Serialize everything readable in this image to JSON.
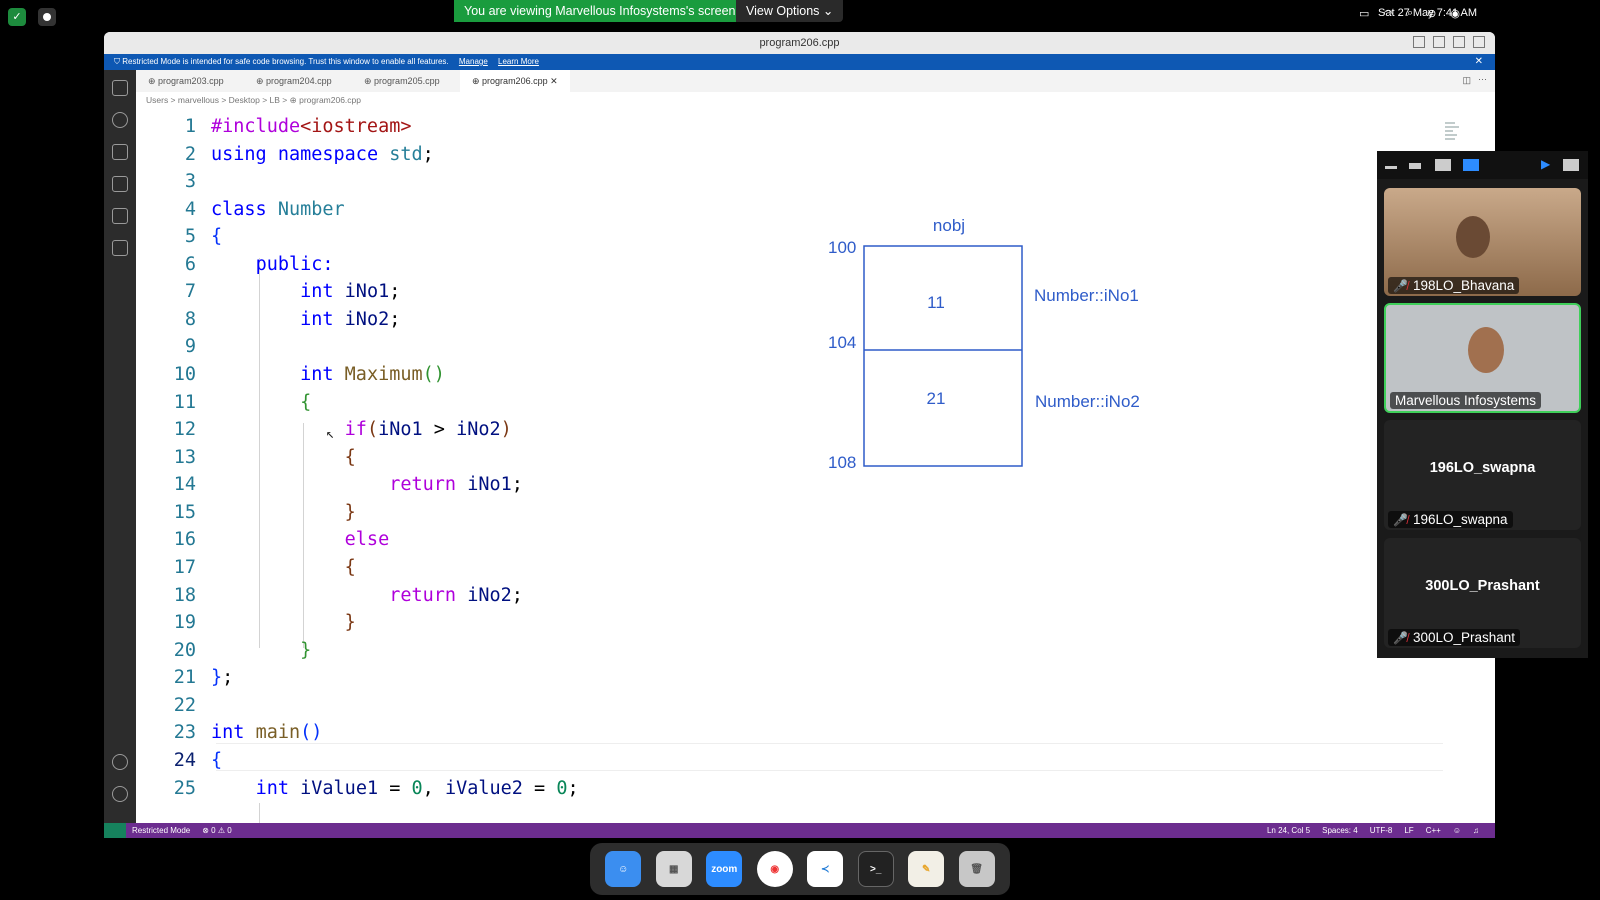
{
  "menubar": {
    "share_banner": "You are viewing Marvellous Infosystems's screen",
    "view_options": "View Options ⌄",
    "clock": "Sat 27 May  7:41 AM"
  },
  "window": {
    "title": "program206.cpp",
    "restricted_text": "Restricted Mode is intended for safe code browsing. Trust this window to enable all features.",
    "manage_link": "Manage",
    "learn_more_link": "Learn More"
  },
  "tabs": [
    {
      "label": "program203.cpp"
    },
    {
      "label": "program204.cpp"
    },
    {
      "label": "program205.cpp"
    },
    {
      "label": "program206.cpp"
    }
  ],
  "breadcrumb": "Users > marvellous > Desktop > LB > ⊕ program206.cpp",
  "line_numbers": [
    "1",
    "2",
    "3",
    "4",
    "5",
    "6",
    "7",
    "8",
    "9",
    "10",
    "11",
    "12",
    "13",
    "14",
    "15",
    "16",
    "17",
    "18",
    "19",
    "20",
    "21",
    "22",
    "23",
    "24",
    "25"
  ],
  "diagram": {
    "object_label": "nobj",
    "addresses": [
      "100",
      "104",
      "108"
    ],
    "values": [
      "11",
      "21"
    ],
    "member_labels": [
      "Number::iNo1",
      "Number::iNo2"
    ]
  },
  "statusbar": {
    "restricted": "Restricted Mode",
    "problems": "⊗ 0 ⚠ 0",
    "position": "Ln 24, Col 5",
    "spaces": "Spaces: 4",
    "encoding": "UTF-8",
    "eol": "LF",
    "language": "C++"
  },
  "participants": [
    {
      "name": "198LO_Bhavana",
      "muted": true
    },
    {
      "name": "Marvellous Infosystems",
      "muted": false
    },
    {
      "name": "196LO_swapna",
      "muted": true
    },
    {
      "name": "300LO_Prashant",
      "muted": true
    }
  ],
  "dock": {
    "zoom_label": "zoom"
  }
}
